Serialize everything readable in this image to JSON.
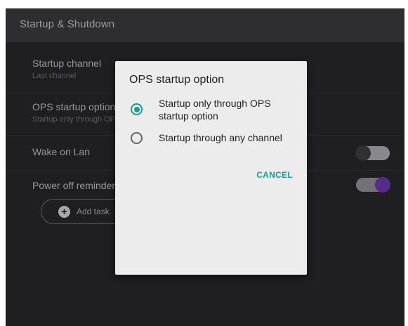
{
  "screen": {
    "title": "Startup & Shutdown"
  },
  "settings": {
    "startup_channel": {
      "label": "Startup channel",
      "value": "Last channel"
    },
    "ops_startup_option": {
      "label": "OPS startup option",
      "value": "Startup only through OPS startup option"
    },
    "wake_on_lan": {
      "label": "Wake on Lan",
      "enabled": false
    },
    "power_off_reminder": {
      "label": "Power off reminder",
      "enabled": true
    },
    "add_task_label": "Add task"
  },
  "dialog": {
    "title": "OPS startup option",
    "options": [
      {
        "label": "Startup only through OPS startup option",
        "selected": true
      },
      {
        "label": "Startup through any channel",
        "selected": false
      }
    ],
    "cancel_label": "CANCEL"
  },
  "colors": {
    "accent": "#1a9b93",
    "toggle_on_knob": "#6b35a6",
    "background": "#262528",
    "dialog_background": "#ececec"
  },
  "icons": {
    "add": "plus-circle-icon",
    "back": "chevron-left-icon"
  }
}
